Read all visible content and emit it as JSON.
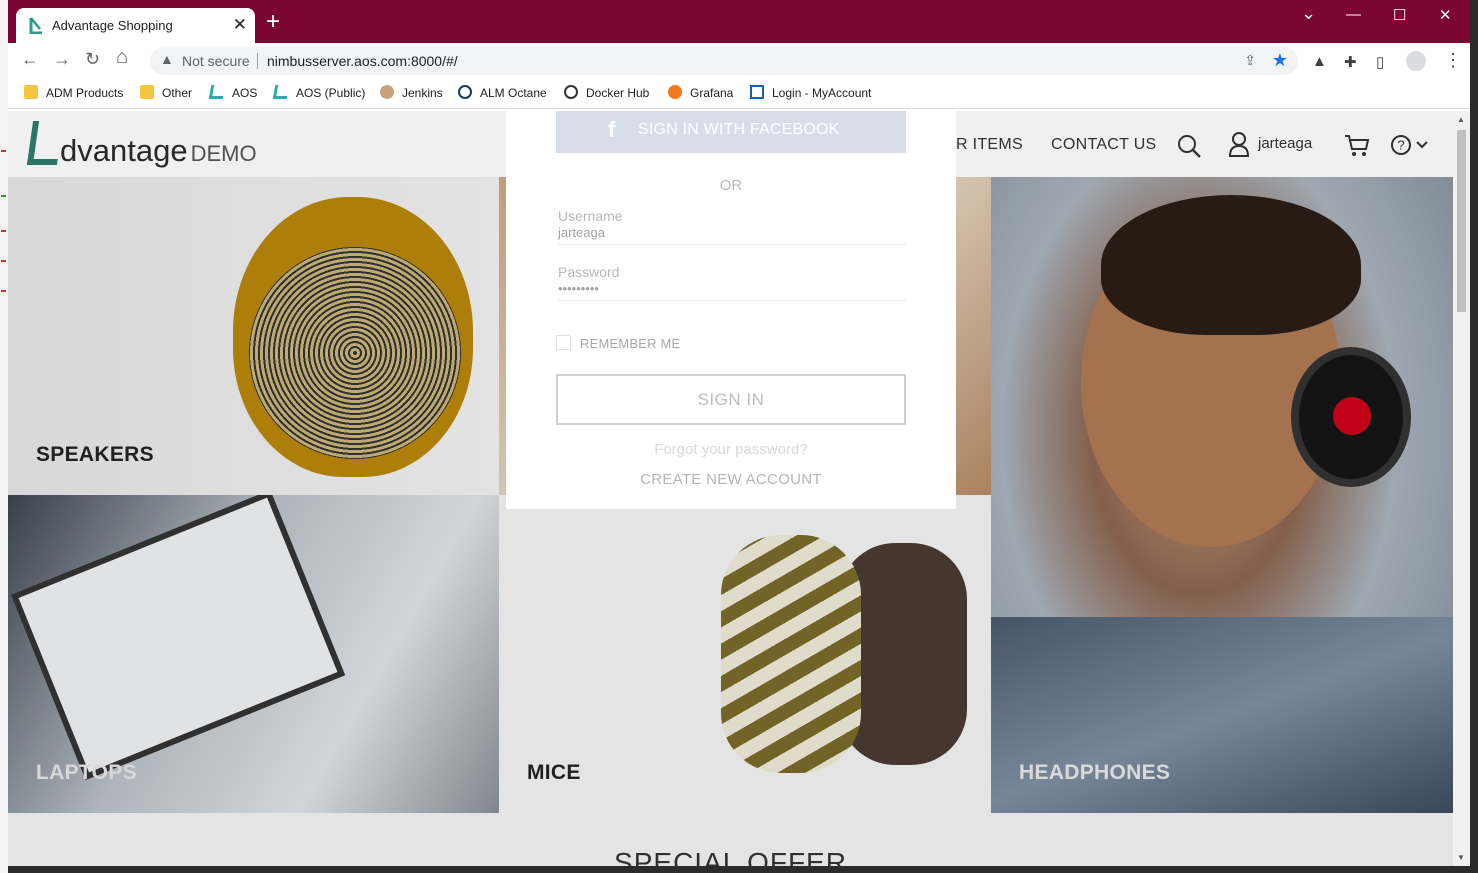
{
  "browser": {
    "tab_title": "Advantage Shopping",
    "tab_close": "✕",
    "new_tab": "+",
    "window_controls": {
      "dropdown": "⌄",
      "minimize": "—",
      "maximize": "☐",
      "close": "✕"
    },
    "nav": {
      "back": "←",
      "forward": "→",
      "reload": "↻",
      "home": "⌂"
    },
    "security_label": "Not secure",
    "url": "nimbusserver.aos.com:8000/#/",
    "accent_color": "#7a0631"
  },
  "bookmarks": [
    {
      "label": "ADM Products",
      "icon": "folder-icon"
    },
    {
      "label": "Other",
      "icon": "folder-icon"
    },
    {
      "label": "AOS",
      "icon": "aos-icon"
    },
    {
      "label": "AOS (Public)",
      "icon": "aos-icon"
    },
    {
      "label": "Jenkins",
      "icon": "jenkins-icon"
    },
    {
      "label": "ALM Octane",
      "icon": "octane-icon"
    },
    {
      "label": "Docker Hub",
      "icon": "docker-icon"
    },
    {
      "label": "Grafana",
      "icon": "grafana-icon"
    },
    {
      "label": "Login - MyAccount",
      "icon": "login-icon"
    }
  ],
  "site": {
    "logo_word": "dvantage",
    "logo_demo": "DEMO",
    "nav_partial": "R ITEMS",
    "nav_contact": "CONTACT US",
    "username": "jarteaga",
    "brand_color": "#2e7d6b"
  },
  "categories": {
    "speakers": "SPEAKERS",
    "laptops": "LAPTOPS",
    "mice": "MICE",
    "headphones": "HEADPHONES"
  },
  "special_offer": "SPECIAL OFFER",
  "login_modal": {
    "facebook_button": "SIGN IN WITH FACEBOOK",
    "or_label": "OR",
    "username_placeholder": "Username",
    "username_value": "jarteaga",
    "password_placeholder": "Password",
    "password_value": "•••••••••",
    "remember_me": "REMEMBER ME",
    "sign_in_button": "SIGN IN",
    "forgot_password": "Forgot your password?",
    "create_account": "CREATE NEW ACCOUNT"
  }
}
